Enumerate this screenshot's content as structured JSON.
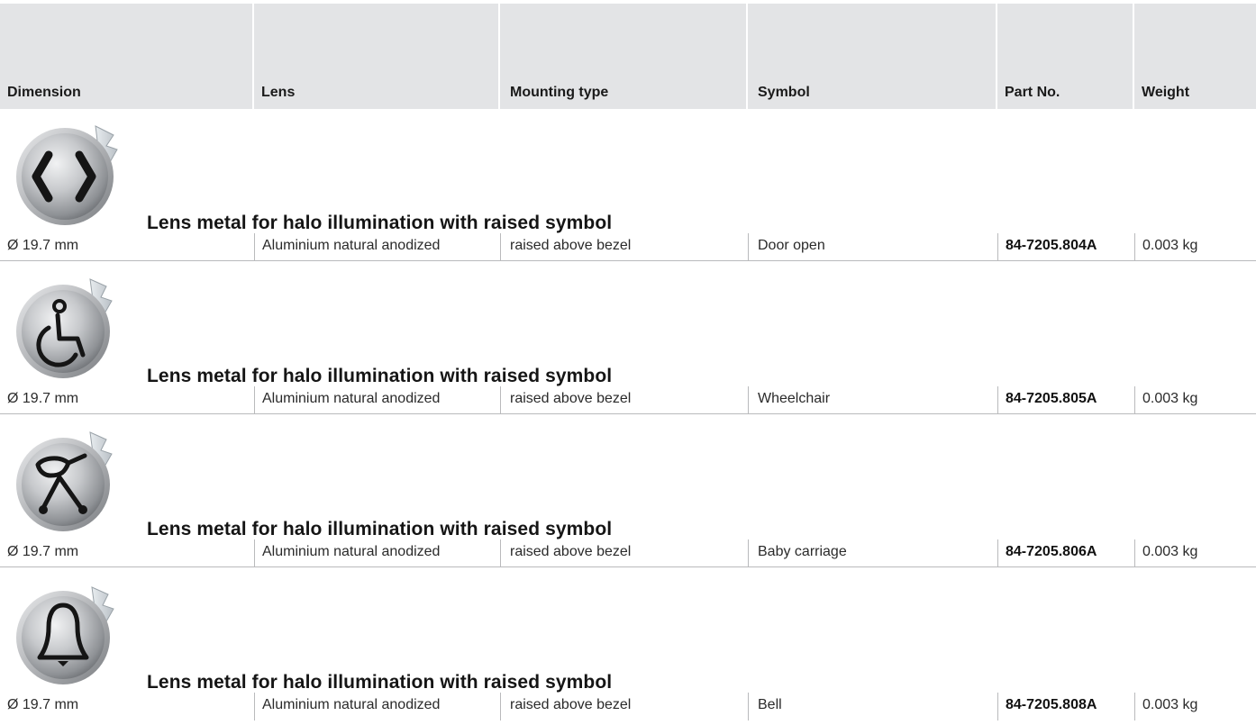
{
  "header": {
    "columns": [
      "Dimension",
      "Lens",
      "Mounting type",
      "Symbol",
      "Part No.",
      "Weight"
    ]
  },
  "products": [
    {
      "icon": "door-open-symbol-icon",
      "title": "Lens metal for halo illumination with raised symbol",
      "dimension": "Ø 19.7 mm",
      "lens": "Aluminium natural anodized",
      "mounting": "raised above bezel",
      "symbol": "Door open",
      "part_no": "84-7205.804A",
      "weight": "0.003 kg"
    },
    {
      "icon": "wheelchair-symbol-icon",
      "title": "Lens metal for halo illumination with raised symbol",
      "dimension": "Ø 19.7 mm",
      "lens": "Aluminium natural anodized",
      "mounting": "raised above bezel",
      "symbol": "Wheelchair",
      "part_no": "84-7205.805A",
      "weight": "0.003 kg"
    },
    {
      "icon": "baby-carriage-symbol-icon",
      "title": "Lens metal for halo illumination with raised symbol",
      "dimension": "Ø 19.7 mm",
      "lens": "Aluminium natural anodized",
      "mounting": "raised above bezel",
      "symbol": "Baby carriage",
      "part_no": "84-7205.806A",
      "weight": "0.003 kg"
    },
    {
      "icon": "bell-symbol-icon",
      "title": "Lens metal for halo illumination with raised symbol",
      "dimension": "Ø 19.7 mm",
      "lens": "Aluminium natural anodized",
      "mounting": "raised above bezel",
      "symbol": "Bell",
      "part_no": "84-7205.808A",
      "weight": "0.003 kg"
    }
  ],
  "colors": {
    "header_bg": "#e3e4e6",
    "rule": "#b9babc",
    "lens_metal": "#b5b7ba",
    "symbol": "#151515"
  }
}
